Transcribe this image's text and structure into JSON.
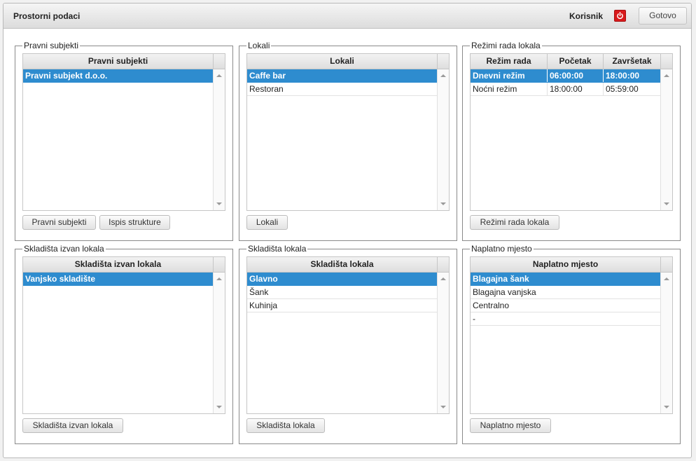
{
  "header": {
    "title": "Prostorni podaci",
    "user_label": "Korisnik",
    "power_icon": "power-icon",
    "done_label": "Gotovo"
  },
  "colors": {
    "selection": "#2e8ccf",
    "power": "#d9191b"
  },
  "panels": {
    "legal": {
      "legend": "Pravni subjekti",
      "header": "Pravni subjekti",
      "rows": [
        "Pravni subjekt d.o.o."
      ],
      "buttons": [
        "Pravni subjekti",
        "Ispis strukture"
      ]
    },
    "venues": {
      "legend": "Lokali",
      "header": "Lokali",
      "rows": [
        "Caffe bar",
        "Restoran"
      ],
      "buttons": [
        "Lokali"
      ]
    },
    "modes": {
      "legend": "Režimi rada lokala",
      "columns": [
        "Režim rada",
        "Početak",
        "Završetak"
      ],
      "rows": [
        [
          "Dnevni režim",
          "06:00:00",
          "18:00:00"
        ],
        [
          "Noćni režim",
          "18:00:00",
          "05:59:00"
        ]
      ],
      "buttons": [
        "Režimi rada lokala"
      ]
    },
    "external_storage": {
      "legend": "Skladišta izvan lokala",
      "header": "Skladišta izvan lokala",
      "rows": [
        "Vanjsko skladište"
      ],
      "buttons": [
        "Skladišta izvan lokala"
      ]
    },
    "venue_storage": {
      "legend": "Skladišta lokala",
      "header": "Skladišta lokala",
      "rows": [
        "Glavno",
        "Šank",
        "Kuhinja"
      ],
      "buttons": [
        "Skladišta lokala"
      ]
    },
    "payment_point": {
      "legend": "Naplatno mjesto",
      "header": "Naplatno mjesto",
      "rows": [
        "Blagajna šank",
        "Blagajna vanjska",
        "Centralno",
        "-"
      ],
      "buttons": [
        "Naplatno mjesto"
      ]
    }
  }
}
